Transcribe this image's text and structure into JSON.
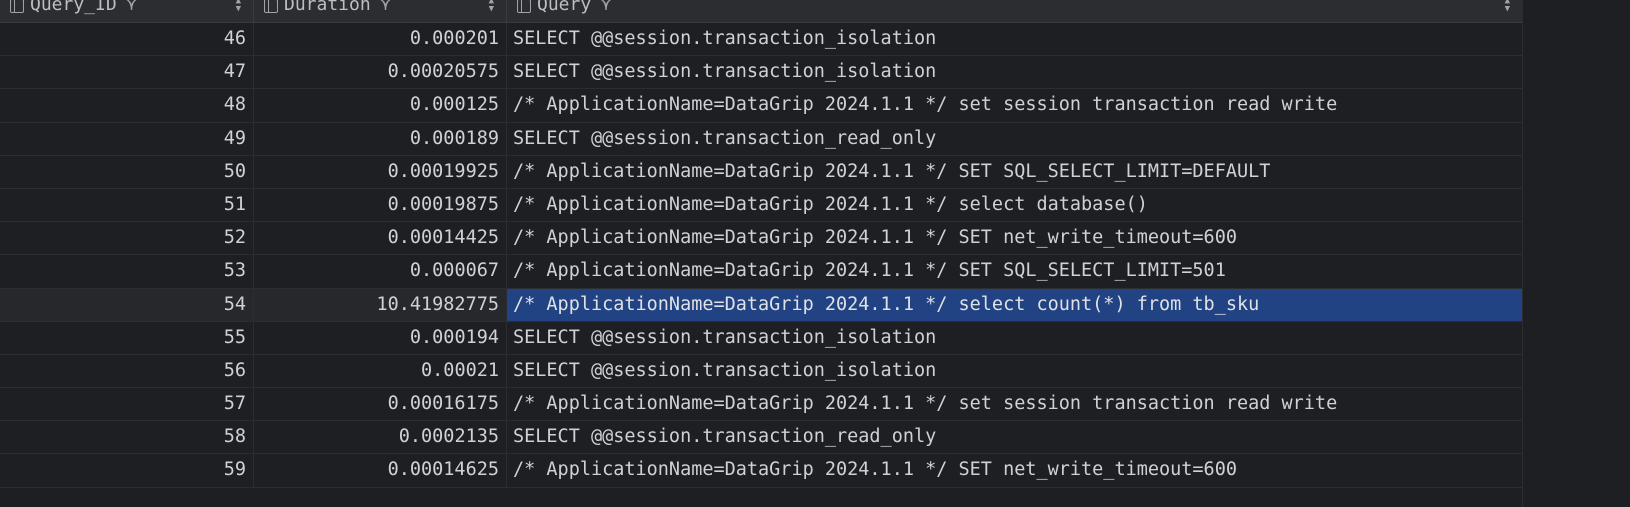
{
  "columns": [
    {
      "label": "Query_ID",
      "icon": "column-icon",
      "filter_icon": "filter-icon",
      "sort_icon": "sort-icon"
    },
    {
      "label": "Duration",
      "icon": "column-icon",
      "filter_icon": "filter-icon",
      "sort_icon": "sort-icon"
    },
    {
      "label": "Query",
      "icon": "column-icon",
      "filter_icon": "filter-icon",
      "sort_icon": "sort-icon"
    }
  ],
  "rows": [
    {
      "id": "46",
      "duration": "0.000201",
      "query": "SELECT @@session.transaction_isolation"
    },
    {
      "id": "47",
      "duration": "0.00020575",
      "query": "SELECT @@session.transaction_isolation"
    },
    {
      "id": "48",
      "duration": "0.000125",
      "query": "/* ApplicationName=DataGrip 2024.1.1 */ set session transaction read write"
    },
    {
      "id": "49",
      "duration": "0.000189",
      "query": "SELECT @@session.transaction_read_only"
    },
    {
      "id": "50",
      "duration": "0.00019925",
      "query": "/* ApplicationName=DataGrip 2024.1.1 */ SET SQL_SELECT_LIMIT=DEFAULT"
    },
    {
      "id": "51",
      "duration": "0.00019875",
      "query": "/* ApplicationName=DataGrip 2024.1.1 */ select database()"
    },
    {
      "id": "52",
      "duration": "0.00014425",
      "query": "/* ApplicationName=DataGrip 2024.1.1 */ SET net_write_timeout=600"
    },
    {
      "id": "53",
      "duration": "0.000067",
      "query": "/* ApplicationName=DataGrip 2024.1.1 */ SET SQL_SELECT_LIMIT=501"
    },
    {
      "id": "54",
      "duration": "10.41982775",
      "query": "/* ApplicationName=DataGrip 2024.1.1 */ select count(*) from tb_sku",
      "selected": true
    },
    {
      "id": "55",
      "duration": "0.000194",
      "query": "SELECT @@session.transaction_isolation"
    },
    {
      "id": "56",
      "duration": "0.00021",
      "query": "SELECT @@session.transaction_isolation"
    },
    {
      "id": "57",
      "duration": "0.00016175",
      "query": "/* ApplicationName=DataGrip 2024.1.1 */ set session transaction read write"
    },
    {
      "id": "58",
      "duration": "0.0002135",
      "query": "SELECT @@session.transaction_read_only"
    },
    {
      "id": "59",
      "duration": "0.00014625",
      "query": "/* ApplicationName=DataGrip 2024.1.1 */ SET net_write_timeout=600"
    }
  ],
  "colors": {
    "background": "#1e1f22",
    "header": "#2b2d30",
    "selection": "#214283",
    "text": "#cfd1d6"
  }
}
